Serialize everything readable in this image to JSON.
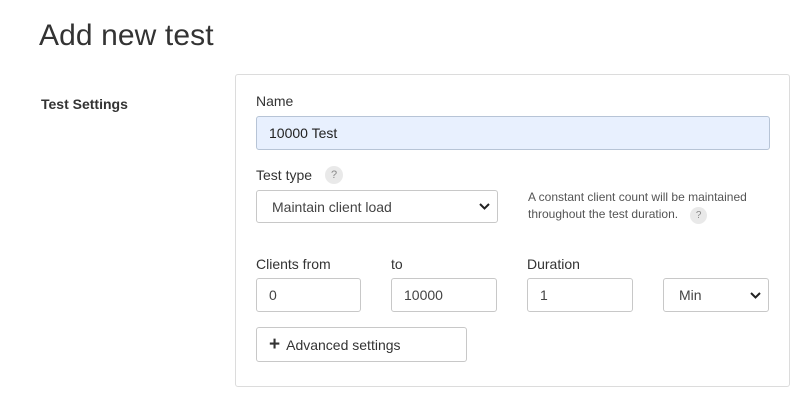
{
  "page": {
    "title": "Add new test"
  },
  "section": {
    "label": "Test Settings"
  },
  "form": {
    "name": {
      "label": "Name",
      "value": "10000 Test"
    },
    "test_type": {
      "label": "Test type",
      "help_icon": "question-icon",
      "help_glyph": "?",
      "selected": "Maintain client load",
      "description_line1": "A constant client count will be maintained",
      "description_line2": "throughout the test duration."
    },
    "clients_from": {
      "label": "Clients from",
      "value": "0"
    },
    "clients_to": {
      "label": "to",
      "value": "10000"
    },
    "duration": {
      "label": "Duration",
      "value": "1"
    },
    "duration_unit": {
      "selected": "Min"
    },
    "advanced": {
      "label": "Advanced settings",
      "icon": "plus-icon",
      "glyph": "+"
    }
  }
}
